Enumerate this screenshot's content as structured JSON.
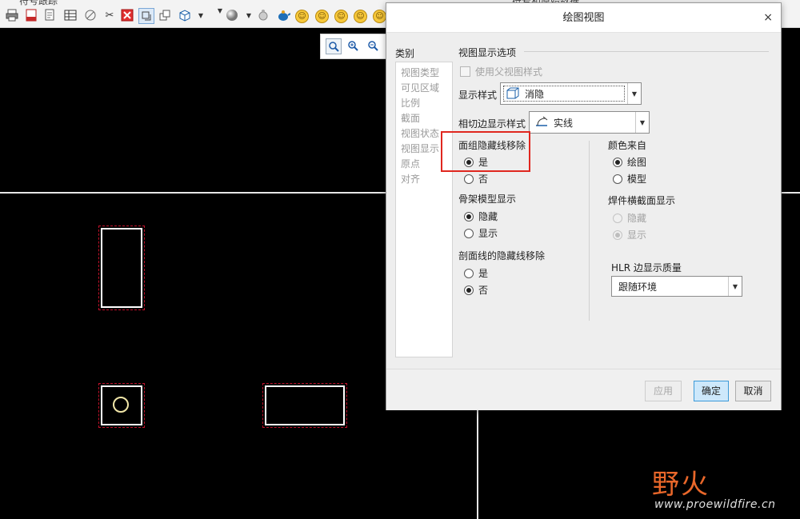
{
  "toolbar": {
    "tab_left_text": "符号跟踪",
    "tab_right_text": "符号和原始数据",
    "icons": [
      "print-icon",
      "pdf-icon",
      "page-setup-icon",
      "table-icon",
      "no-entry-icon",
      "unlink-icon",
      "delete-icon",
      "display-view-icon",
      "view-manager-icon",
      "cube-view-icon",
      "sphere-icon",
      "animation-icon",
      "teapot-icon",
      "smiley-icon"
    ]
  },
  "zoom_toolbar": {
    "icons": [
      "zoom-fit-icon",
      "zoom-in-icon",
      "zoom-out-icon"
    ]
  },
  "watermark": {
    "brand": "野火",
    "url": "www.proewildfire.cn"
  },
  "dialog": {
    "title": "绘图视图",
    "close_glyph": "×",
    "category_label": "类别",
    "categories": [
      "视图类型",
      "可见区域",
      "比例",
      "截面",
      "视图状态",
      "视图显示",
      "原点",
      "对齐"
    ],
    "section_title": "视图显示选项",
    "use_parent_style": "使用父视图样式",
    "display_style": {
      "label": "显示样式",
      "value": "消隐"
    },
    "tangent_edge_style": {
      "label": "相切边显示样式",
      "value": "实线"
    },
    "face_group_hidden_line_removal": {
      "label": "面组隐藏线移除",
      "options": [
        "是",
        "否"
      ],
      "selected": "是"
    },
    "skeleton_model_display": {
      "label": "骨架模型显示",
      "options": [
        "隐藏",
        "显示"
      ],
      "selected": "隐藏"
    },
    "xsec_hidden_line_removal": {
      "label": "剖面线的隐藏线移除",
      "options": [
        "是",
        "否"
      ],
      "selected": "否"
    },
    "color_from": {
      "label": "颜色来自",
      "options": [
        "绘图",
        "模型"
      ],
      "selected": "绘图"
    },
    "weld_section_display": {
      "label": "焊件横截面显示",
      "options": [
        "隐藏",
        "显示"
      ],
      "selected": "显示"
    },
    "hlr_edge_quality": {
      "label": "HLR 边显示质量",
      "value": "跟随环境"
    },
    "buttons": {
      "apply": "应用",
      "ok": "确定",
      "cancel": "取消"
    }
  },
  "colors": {
    "highlight_box": "#e0271f",
    "primary_button": "#cde8fb",
    "drawing_background": "#000000",
    "watermark_brand": "#e9672a"
  }
}
